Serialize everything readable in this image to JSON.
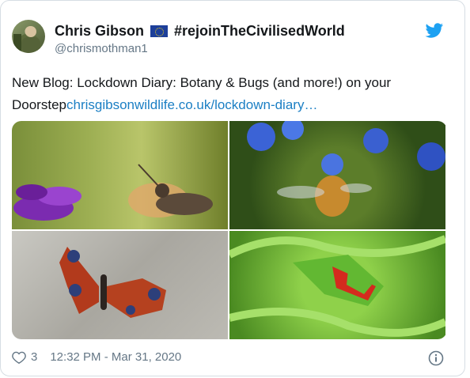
{
  "user": {
    "display_name": "Chris Gibson",
    "flag": "EU flag",
    "hashtag": "#rejoinTheCivilisedWorld",
    "handle": "@chrismothman1"
  },
  "tweet": {
    "text_prefix": "New Blog: Lockdown Diary: Botany & Bugs (and more!) on your Doorstep",
    "link_text": "chrisgibsonwildlife.co.uk/lockdown-diary…"
  },
  "media": [
    {
      "label": "hummingbird hawk-moth on purple flowers"
    },
    {
      "label": "bee-fly on blue flowers"
    },
    {
      "label": "peacock butterfly on stone"
    },
    {
      "label": "shield bug on fern"
    }
  ],
  "footer": {
    "likes": "3",
    "timestamp": "12:32 PM - Mar 31, 2020"
  },
  "colors": {
    "link": "#1b7fc4",
    "twitter_blue": "#1da1f2",
    "muted": "#657786"
  }
}
